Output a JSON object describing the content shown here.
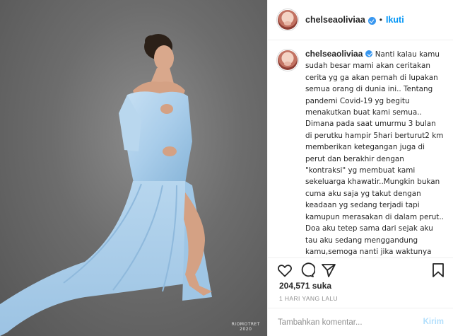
{
  "header": {
    "username": "chelseaoliviaa",
    "dot": "•",
    "follow_label": "Ikuti"
  },
  "caption": {
    "username": "chelseaoliviaa",
    "text": "Nanti kalau kamu sudah besar mami akan ceritakan cerita yg ga akan pernah di lupakan semua orang di dunia ini.. Tentang pandemi Covid-19 yg begitu menakutkan buat kami semua.. Dimana pada saat umurmu 3 bulan di perutku hampir 5hari berturut2 km memberikan ketegangan juga di perut dan berakhir dengan \"kontraksi\" yg membuat kami sekeluarga khawatir..Mungkin bukan cuma aku saja yg takut dengan keadaan yg sedang terjadi tapi kamupun merasakan di dalam perut.. Doa aku tetep sama dari sejak aku tau aku sedang menggandung kamu,semoga nanti jika waktunya km akan lahir semoga bumi ini sudah kembali sehat",
    "heart": "♥"
  },
  "photo": {
    "credit_line1": "RIOMOTRET",
    "credit_line2": "2020"
  },
  "actions": {
    "icons": [
      "heart-icon",
      "comment-icon",
      "share-icon",
      "bookmark-icon"
    ]
  },
  "likes": "204,571 suka",
  "timestamp": "1 HARI YANG LALU",
  "comment": {
    "placeholder": "Tambahkan komentar...",
    "post_label": "Kirim"
  },
  "colors": {
    "accent": "#0095f6",
    "verified": "#3897f0",
    "heart": "#ed4956",
    "post_disabled": "#b2dffc",
    "dress": "#a9cdea"
  }
}
